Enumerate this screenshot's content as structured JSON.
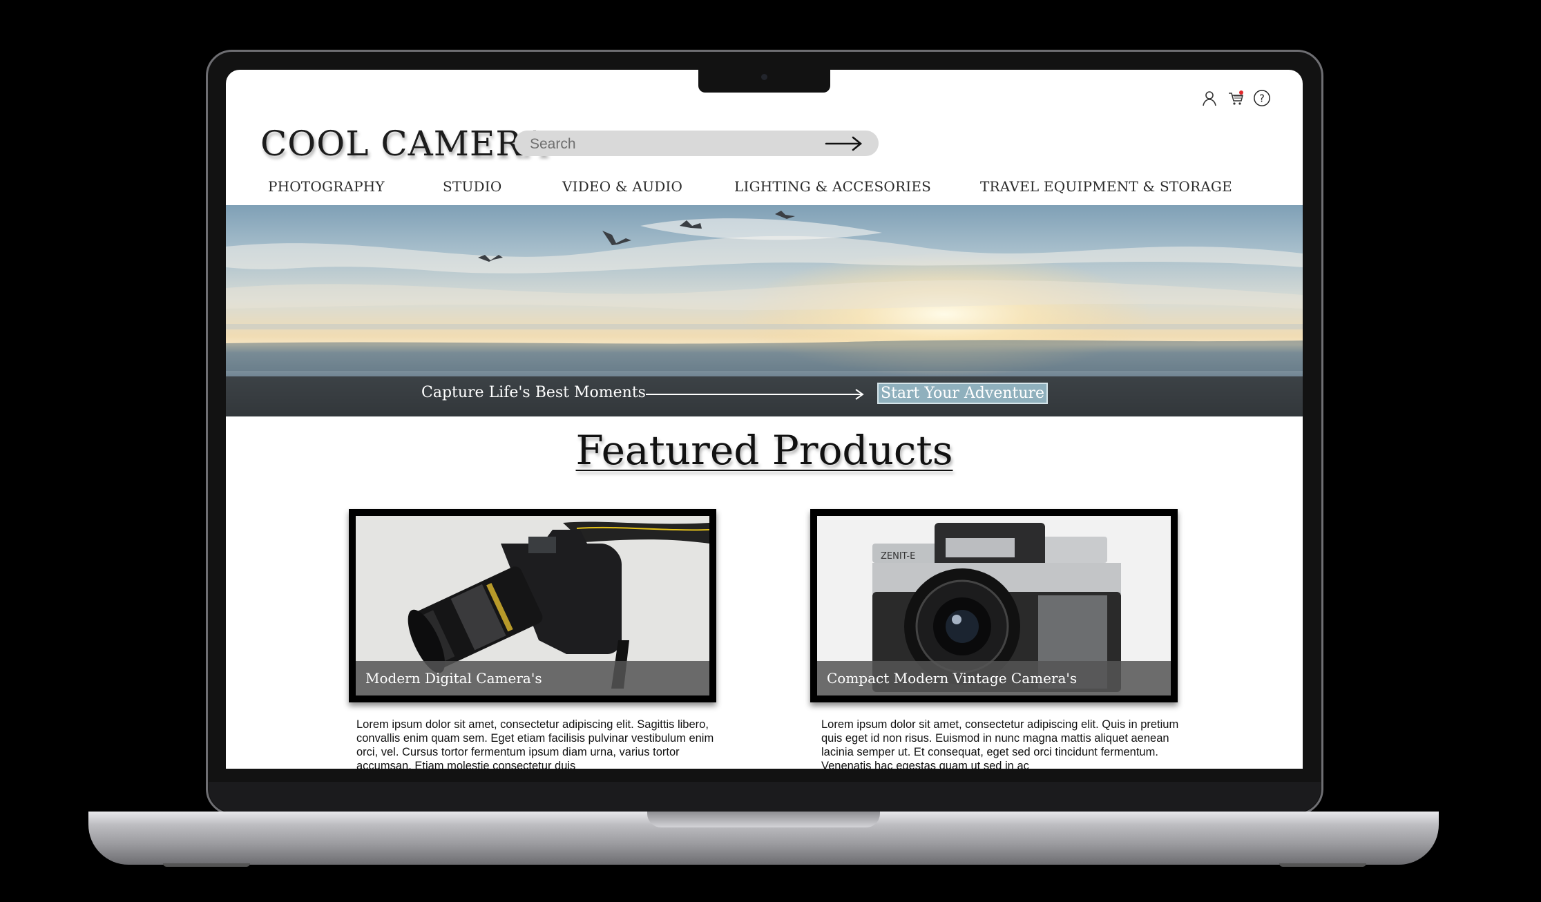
{
  "site": {
    "logo": "COOL CAMERA",
    "search": {
      "placeholder": "Search"
    }
  },
  "header_icons": [
    "user-icon",
    "cart-icon",
    "help-icon"
  ],
  "nav": {
    "items": [
      {
        "label": "PHOTOGRAPHY"
      },
      {
        "label": "STUDIO"
      },
      {
        "label": "VIDEO & AUDIO"
      },
      {
        "label": "LIGHTING & ACCESORIES"
      },
      {
        "label": "TRAVEL EQUIPMENT & STORAGE"
      }
    ]
  },
  "hero": {
    "tagline": "Capture Life's Best Moments",
    "cta": "Start Your Adventure"
  },
  "featured": {
    "title": "Featured Products",
    "products": [
      {
        "name": "Modern Digital Camera's",
        "description": "Lorem ipsum dolor sit amet, consectetur adipiscing elit. Sagittis libero, convallis enim quam sem. Eget etiam facilisis pulvinar vestibulum enim orci, vel. Cursus tortor fermentum ipsum diam urna, varius tortor accumsan. Etiam molestie consectetur duis"
      },
      {
        "name": "Compact Modern Vintage Camera's",
        "description": "Lorem ipsum dolor sit amet, consectetur adipiscing elit. Quis in pretium quis eget id non risus. Euismod in nunc magna mattis aliquet aenean lacinia semper ut. Et consequat, eget sed orci tincidunt fermentum. Venenatis hac egestas quam ut sed in ac"
      }
    ]
  },
  "colors": {
    "cta_bg": "#8fb0bd",
    "search_bg": "#d9d9d9",
    "cart_badge": "#e0292c"
  }
}
